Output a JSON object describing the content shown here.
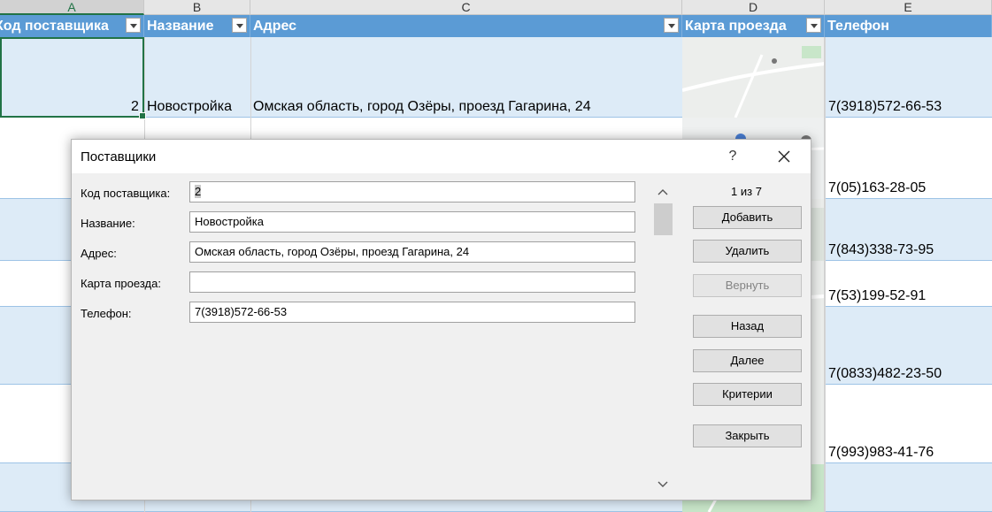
{
  "sheet": {
    "columns": [
      "A",
      "B",
      "C",
      "D",
      "E"
    ],
    "headers": {
      "supplier_code": "Код поставщика",
      "name": "Название",
      "address": "Адрес",
      "map": "Карта проезда",
      "phone": "Телефон"
    },
    "row1": {
      "supplier_code": "2",
      "name": "Новостройка",
      "address": "Омская область, город Озёры, проезд Гагарина, 24",
      "phone": "7(3918)572-66-53"
    },
    "phones": [
      "7(05)163-28-05",
      "7(843)338-73-95",
      "7(53)199-52-91",
      "7(0833)482-23-50",
      "7(993)983-41-76"
    ]
  },
  "dialog": {
    "title": "Поставщики",
    "help": "?",
    "record_counter": "1 из 7",
    "fields": {
      "code_label": "Код поставщика:",
      "code_value": "2",
      "name_label": "Название:",
      "name_value": "Новостройка",
      "address_label": "Адрес:",
      "address_value": "Омская область, город Озёры, проезд Гагарина, 24",
      "map_label": "Карта проезда:",
      "map_value": "",
      "phone_label": "Телефон:",
      "phone_value": "7(3918)572-66-53"
    },
    "buttons": {
      "add": "Добавить",
      "delete": "Удалить",
      "restore": "Вернуть",
      "back": "Назад",
      "next": "Далее",
      "criteria": "Критерии",
      "close": "Закрыть"
    }
  },
  "colors": {
    "table_header": "#5b9bd5",
    "band": "#ddebf7",
    "selection": "#217346"
  }
}
